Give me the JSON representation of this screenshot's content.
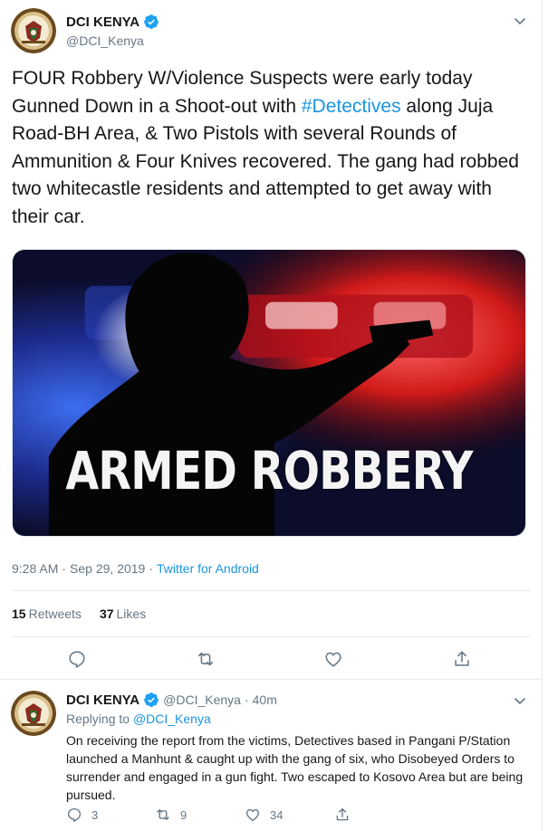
{
  "tweet": {
    "display_name": "DCI KENYA",
    "handle": "@DCI_Kenya",
    "text_before": "FOUR Robbery W/Violence Suspects were early today Gunned Down in a Shoot-out with ",
    "hashtag": "#Detectives",
    "text_after": " along Juja Road-BH Area, & Two Pistols with several Rounds of Ammunition & Four Knives recovered. The gang had robbed two whitecastle residents and attempted to get away with their car.",
    "media_caption": "ARMED ROBBERY",
    "time": "9:28 AM",
    "date": "Sep 29, 2019",
    "separator": "·",
    "source": "Twitter for Android",
    "retweets_count": "15",
    "retweets_label": "Retweets",
    "likes_count": "37",
    "likes_label": "Likes"
  },
  "reply": {
    "display_name": "DCI KENYA",
    "handle": "@DCI_Kenya",
    "separator": "·",
    "age": "40m",
    "replying_label": "Replying to",
    "replying_to": "@DCI_Kenya",
    "text": "On receiving the report from the victims, Detectives based in Pangani P/Station launched a Manhunt & caught up with the gang of six, who Disobeyed Orders to surrender and engaged in a gun fight. Two  escaped to Kosovo Area but are being pursued.",
    "reply_count": "3",
    "retweet_count": "9",
    "like_count": "34"
  },
  "colors": {
    "link": "#1b95e0",
    "verified": "#1da1f2",
    "secondary_text": "#657786",
    "border": "#e6ecf0"
  },
  "icons": [
    "verified-badge-icon",
    "chevron-down-icon",
    "reply-icon",
    "retweet-icon",
    "like-icon",
    "share-icon"
  ]
}
